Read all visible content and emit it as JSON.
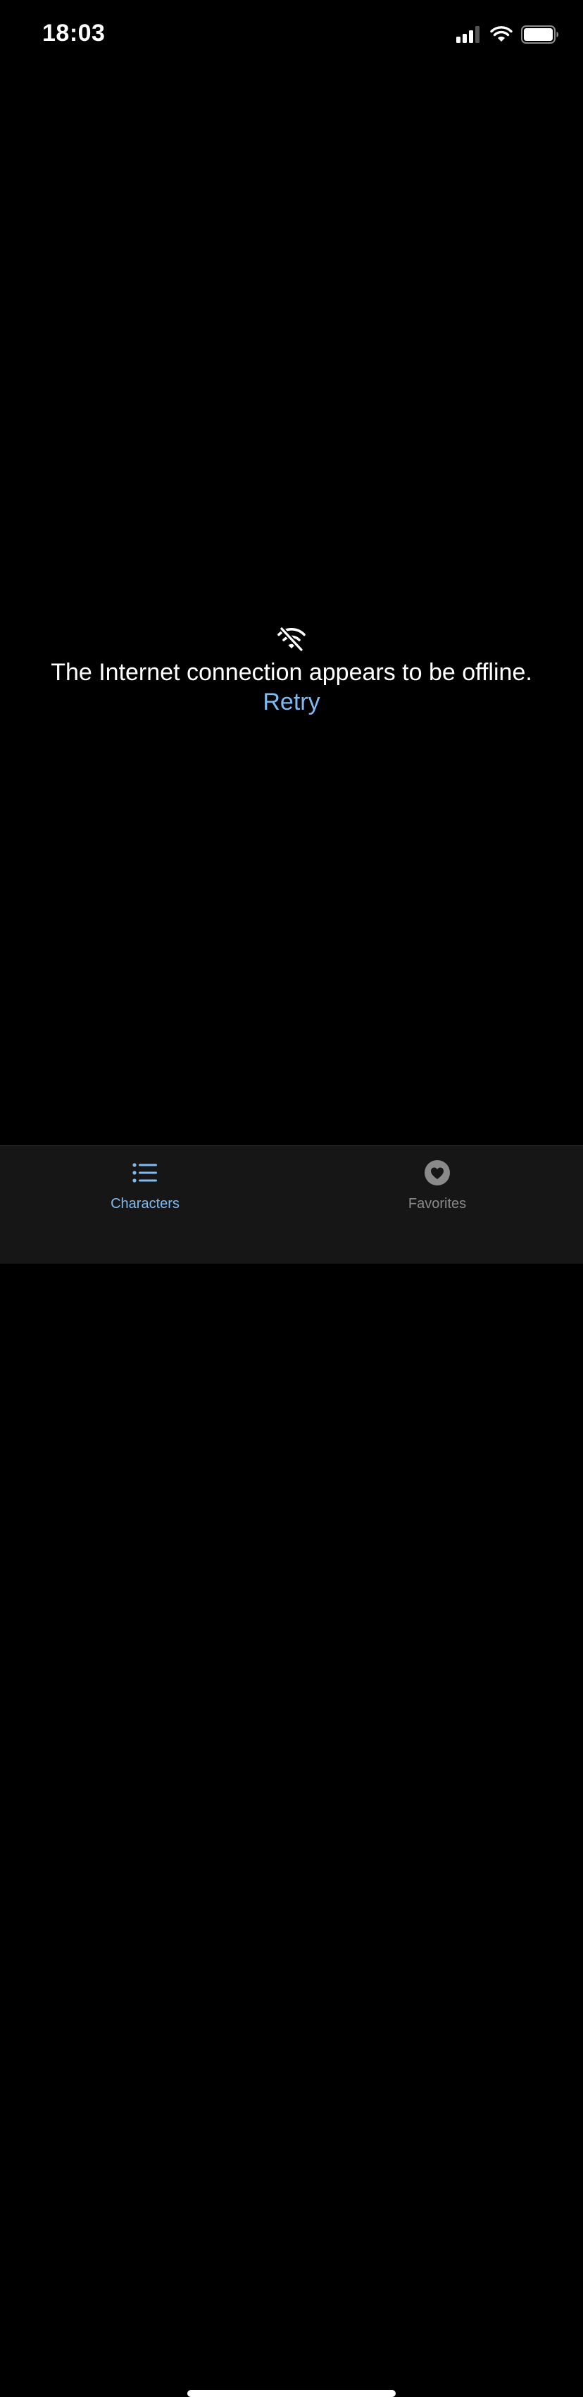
{
  "status_bar": {
    "time": "18:03",
    "icons": [
      "cellular-signal-icon",
      "wifi-icon",
      "battery-icon"
    ]
  },
  "offline": {
    "icon": "wifi-off-icon",
    "message": "The Internet connection appears to be offline.",
    "retry_label": "Retry"
  },
  "tab_bar": {
    "tabs": [
      {
        "label": "Characters",
        "icon": "list-icon",
        "selected": true
      },
      {
        "label": "Favorites",
        "icon": "heart-circle-icon",
        "selected": false
      }
    ]
  },
  "colors": {
    "background": "#000000",
    "accent": "#7fbaf0",
    "tab_bar_background": "#161616",
    "inactive": "#8a8a8a"
  }
}
